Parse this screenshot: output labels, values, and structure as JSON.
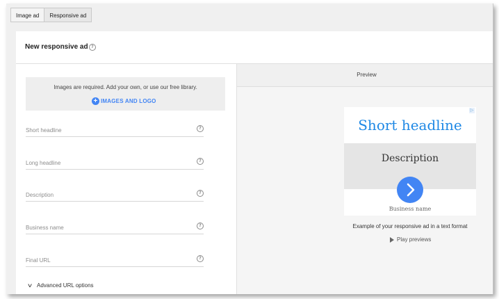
{
  "tabs": [
    {
      "label": "Image ad"
    },
    {
      "label": "Responsive ad"
    }
  ],
  "header": {
    "title": "New responsive ad",
    "help_icon": "help-circle-icon"
  },
  "form": {
    "images_message": "Images are required. Add your own, or use our free library.",
    "images_button": "IMAGES AND LOGO",
    "fields": [
      {
        "label": "Short headline"
      },
      {
        "label": "Long headline"
      },
      {
        "label": "Description"
      },
      {
        "label": "Business name"
      },
      {
        "label": "Final URL"
      }
    ],
    "advanced_label": "Advanced URL options"
  },
  "preview": {
    "title": "Preview",
    "ad": {
      "headline": "Short headline",
      "description": "Description",
      "business": "Business name"
    },
    "example_text": "Example of your responsive ad in a text format",
    "play_label": "Play previews"
  },
  "colors": {
    "accent": "#4285f4",
    "headline": "#1e88e5"
  }
}
